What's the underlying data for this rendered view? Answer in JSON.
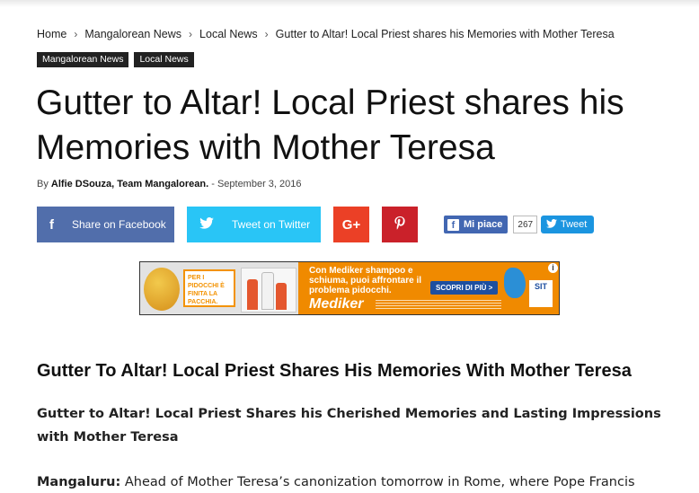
{
  "breadcrumb": {
    "items": [
      "Home",
      "Mangalorean News",
      "Local News",
      "Gutter to Altar! Local Priest shares his Memories with Mother Teresa"
    ],
    "separator": "›"
  },
  "categories": [
    "Mangalorean News",
    "Local News"
  ],
  "article": {
    "title": "Gutter to Altar! Local Priest shares his Memories with Mother Teresa",
    "by_label": "By",
    "author": "Alfie DSouza, Team Mangalorean.",
    "dash": "-",
    "date": "September 3, 2016"
  },
  "share": {
    "facebook_icon": "f",
    "facebook_label": "Share on Facebook",
    "twitter_icon": "🐦",
    "twitter_label": "Tweet on Twitter",
    "googleplus_icon": "G+",
    "pinterest_icon": "P",
    "fb_like_icon": "f",
    "fb_like_label": "Mi piace",
    "fb_like_count": "267",
    "tweet_icon": "🐦",
    "tweet_label": "Tweet"
  },
  "ad": {
    "left_text": "PER I PIDOCCHI È FINITA LA PACCHIA.",
    "message": "Con Mediker shampoo e schiuma, puoi affrontare il problema pidocchi.",
    "brand": "Mediker",
    "cta": "SCOPRI DI PIÙ >",
    "sit": "SIT",
    "info": "i"
  },
  "content": {
    "heading": "Gutter To Altar! Local Priest Shares His Memories With Mother Teresa",
    "lead": "Gutter to Altar! Local Priest Shares his Cherished Memories and Lasting Impressions with Mother Teresa",
    "para_place": "Mangaluru:",
    "para_text": "Ahead of Mother Teresa’s canonization tomorrow in Rome, where Pope Francis"
  },
  "colors": {
    "facebook": "#516eab",
    "twitter": "#29c5f6",
    "googleplus": "#eb4026",
    "pinterest": "#ca212a",
    "category_bg": "#222222",
    "ad_orange": "#f08a00"
  }
}
